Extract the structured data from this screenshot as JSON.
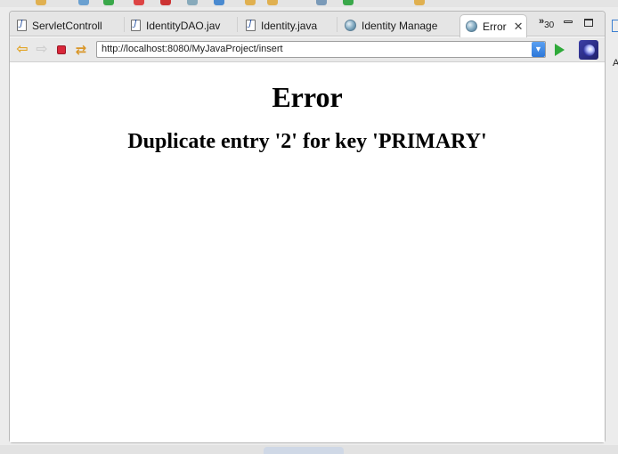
{
  "tabs": [
    {
      "label": "ServletControll",
      "icon": "java-file-icon"
    },
    {
      "label": "IdentityDAO.jav",
      "icon": "java-file-icon"
    },
    {
      "label": "Identity.java",
      "icon": "java-file-icon"
    },
    {
      "label": "Identity Manage",
      "icon": "globe-icon"
    },
    {
      "label": "Error",
      "icon": "globe-icon",
      "active": true
    }
  ],
  "tab_overflow": {
    "chevron": "»",
    "count": "30"
  },
  "browser": {
    "url": "http://localhost:8080/MyJavaProject/insert"
  },
  "page": {
    "heading": "Error",
    "message": "Duplicate entry '2' for key 'PRIMARY'"
  },
  "side": {
    "letter": "A"
  },
  "colors": {
    "accent_blue": "#2d77d8",
    "stop_red": "#d9273a",
    "go_green": "#2faa3a",
    "back_arrow": "#e2a62b"
  }
}
